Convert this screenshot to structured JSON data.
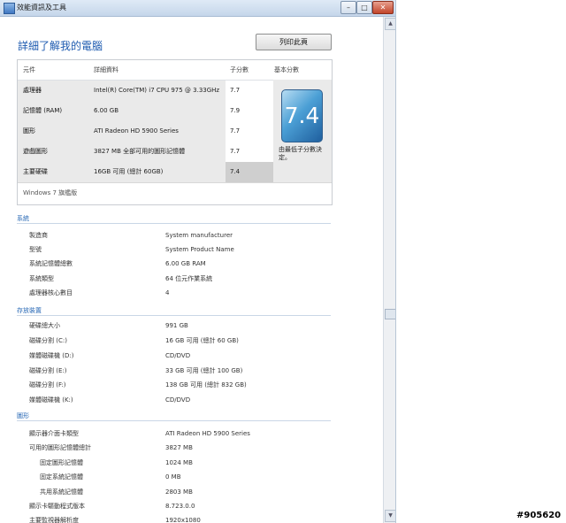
{
  "window": {
    "title": "效能資訊及工具",
    "controls": [
      "–",
      "□",
      "✕"
    ]
  },
  "header": {
    "page_title": "詳細了解我的電腦",
    "print_button": "列印此頁"
  },
  "score_table": {
    "columns": [
      "元件",
      "詳細資料",
      "子分數",
      "基本分數"
    ],
    "rows": [
      {
        "component": "處理器",
        "detail": "Intel(R) Core(TM) i7 CPU 975 @ 3.33GHz",
        "subscore": "7.7"
      },
      {
        "component": "記憶體 (RAM)",
        "detail": "6.00 GB",
        "subscore": "7.9"
      },
      {
        "component": "圖形",
        "detail": "ATI Radeon HD 5900 Series",
        "subscore": "7.7"
      },
      {
        "component": "遊戲圖形",
        "detail": "3827 MB 全部可用的圖形記憶體",
        "subscore": "7.7"
      },
      {
        "component": "主要硬碟",
        "detail": "16GB 可用 (總計 60GB)",
        "subscore": "7.4"
      }
    ],
    "base_score": "7.4",
    "base_note": "由最低子分數決定。",
    "edition": "Windows 7 旗艦版"
  },
  "system": {
    "heading": "系統",
    "rows": [
      {
        "k": "製造商",
        "v": "System manufacturer"
      },
      {
        "k": "型號",
        "v": "System Product Name"
      },
      {
        "k": "系統記憶體總數",
        "v": "6.00 GB RAM"
      },
      {
        "k": "系統類型",
        "v": "64 位元作業系統"
      },
      {
        "k": "處理器核心數目",
        "v": "4"
      }
    ]
  },
  "storage": {
    "heading": "存放裝置",
    "rows": [
      {
        "k": "硬碟總大小",
        "v": "991 GB"
      },
      {
        "k": "磁碟分割 (C:)",
        "v": "16 GB 可用 (總計 60 GB)"
      },
      {
        "k": "媒體磁碟機 (D:)",
        "v": "CD/DVD"
      },
      {
        "k": "磁碟分割 (E:)",
        "v": "33 GB 可用 (總計 100 GB)"
      },
      {
        "k": "磁碟分割 (F:)",
        "v": "138 GB 可用 (總計 832 GB)"
      },
      {
        "k": "媒體磁碟機 (K:)",
        "v": "CD/DVD"
      }
    ]
  },
  "graphics": {
    "heading": "圖形",
    "rows": [
      {
        "k": "顯示器介面卡類型",
        "v": "ATI Radeon HD 5900 Series"
      },
      {
        "k": "可用的圖形記憶體總計",
        "v": "3827 MB"
      },
      {
        "k": "固定圖形記憶體",
        "v": "1024 MB"
      },
      {
        "k": "固定系統記憶體",
        "v": "0 MB"
      },
      {
        "k": "共用系統記憶體",
        "v": "2803 MB"
      },
      {
        "k": "顯示卡驅動程式版本",
        "v": "8.723.0.0"
      },
      {
        "k": "主要監視器解析度",
        "v": "1920x1080"
      }
    ]
  },
  "watermark": "#905620"
}
